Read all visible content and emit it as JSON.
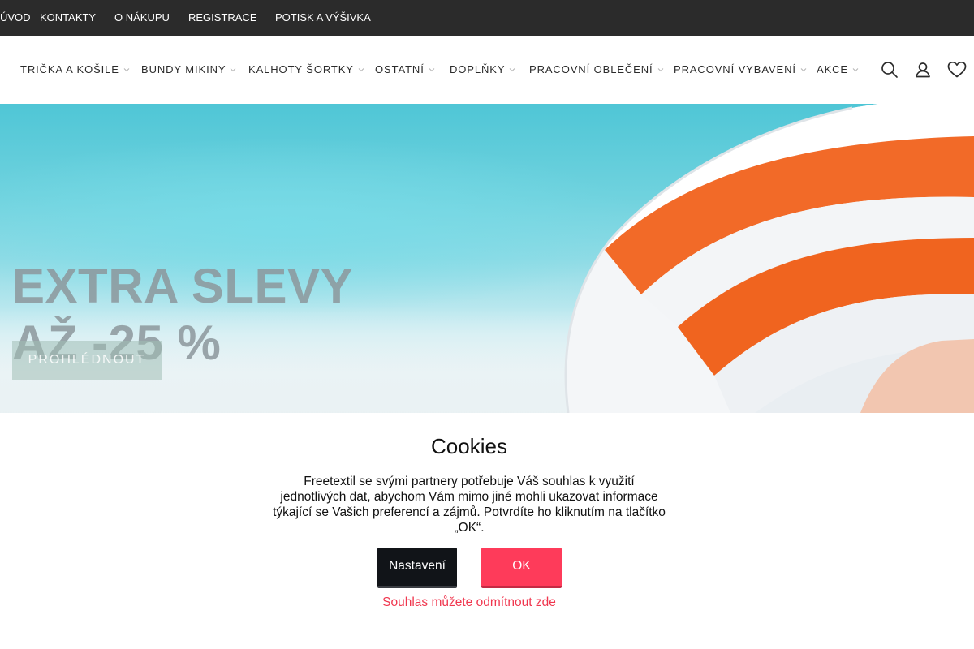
{
  "topbar": {
    "links": [
      "ÚVOD",
      "KONTAKTY",
      "O NÁKUPU",
      "REGISTRACE",
      "POTISK A VÝŠIVKA"
    ]
  },
  "nav": {
    "items": [
      "TRIČKA A KOŠILE",
      "BUNDY MIKINY",
      "KALHOTY ŠORTKY",
      "OSTATNÍ",
      "DOPLŇKY",
      "PRACOVNÍ OBLEČENÍ",
      "PRACOVNÍ VYBAVENÍ",
      "AKCE"
    ],
    "icons": [
      "search-icon",
      "user-icon",
      "heart-icon"
    ]
  },
  "hero": {
    "title_line1": "EXTRA SLEVY",
    "title_line2": "AŽ -25 %",
    "button_label": "PROHLÉDNOUT"
  },
  "cookies": {
    "title": "Cookies",
    "text": "Freetextil se svými partnery potřebuje Váš souhlas k využití jednotlivých dat, abychom Vám mimo jiné mohli ukazovat informace týkající se Vašich preferencí a zájmů. Potvrdíte ho kliknutím na tlačítko „OK“.",
    "settings_label": "Nastavení",
    "ok_label": "OK",
    "reject_label": "Souhlas můžete odmítnout zde"
  },
  "colors": {
    "topbar_bg": "#2b2b2b",
    "accent": "#fe3b5a",
    "dark_button": "#111418"
  }
}
